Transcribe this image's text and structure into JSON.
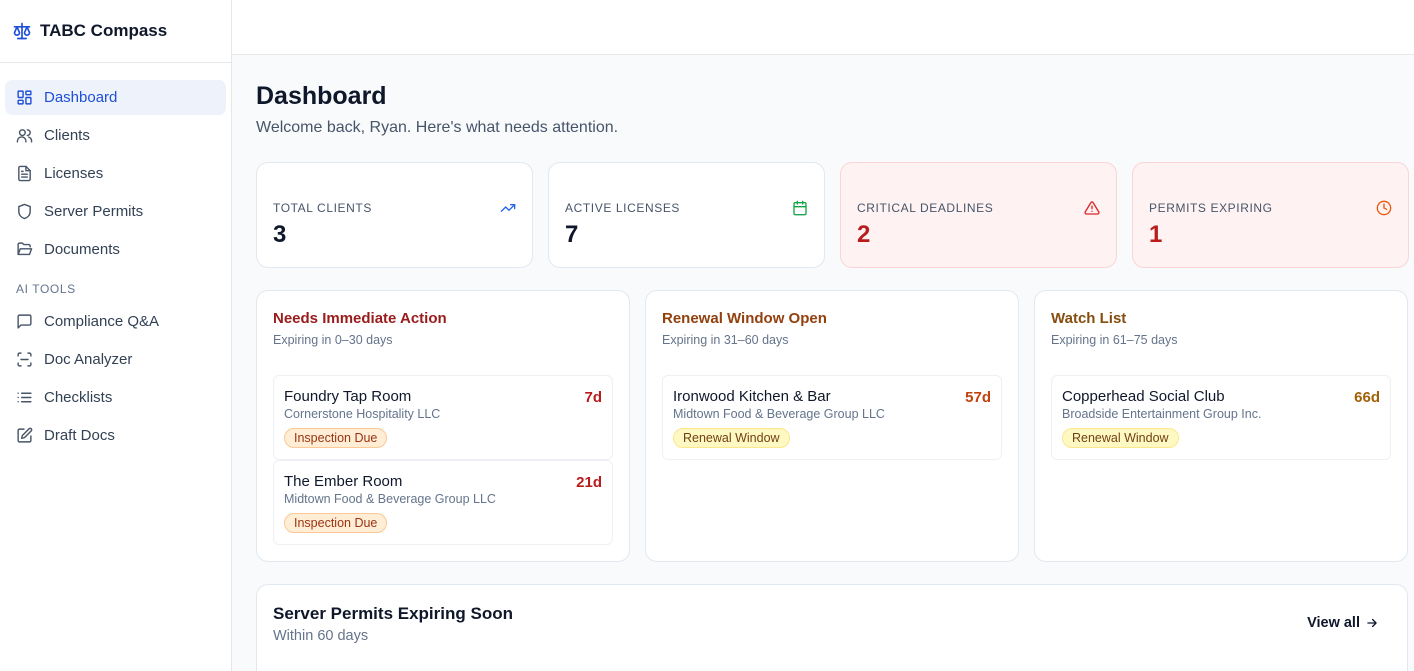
{
  "app": {
    "title": "TABC Compass"
  },
  "nav": {
    "items": [
      {
        "label": "Dashboard"
      },
      {
        "label": "Clients"
      },
      {
        "label": "Licenses"
      },
      {
        "label": "Server Permits"
      },
      {
        "label": "Documents"
      }
    ],
    "ai_section_label": "AI TOOLS",
    "ai_items": [
      {
        "label": "Compliance Q&A"
      },
      {
        "label": "Doc Analyzer"
      },
      {
        "label": "Checklists"
      },
      {
        "label": "Draft Docs"
      }
    ]
  },
  "page": {
    "title": "Dashboard",
    "subtitle": "Welcome back, Ryan. Here's what needs attention."
  },
  "stats": [
    {
      "label": "TOTAL CLIENTS",
      "value": "3",
      "icon": "trending-up-icon",
      "color": "#2563eb"
    },
    {
      "label": "ACTIVE LICENSES",
      "value": "7",
      "icon": "calendar-icon",
      "color": "#16a34a"
    },
    {
      "label": "CRITICAL DEADLINES",
      "value": "2",
      "icon": "alert-triangle-icon",
      "color": "#dc2626"
    },
    {
      "label": "PERMITS EXPIRING",
      "value": "1",
      "icon": "clock-icon",
      "color": "#ea580c"
    }
  ],
  "panels": [
    {
      "title": "Needs Immediate Action",
      "subtitle": "Expiring in 0–30 days",
      "title_color": "#991b1b",
      "entries": [
        {
          "name": "Foundry Tap Room",
          "org": "Cornerstone Hospitality LLC",
          "days": "7d",
          "badge": "Inspection Due"
        },
        {
          "name": "The Ember Room",
          "org": "Midtown Food & Beverage Group LLC",
          "days": "21d",
          "badge": "Inspection Due"
        }
      ]
    },
    {
      "title": "Renewal Window Open",
      "subtitle": "Expiring in 31–60 days",
      "title_color": "#92400e",
      "entries": [
        {
          "name": "Ironwood Kitchen & Bar",
          "org": "Midtown Food & Beverage Group LLC",
          "days": "57d",
          "badge": "Renewal Window"
        }
      ]
    },
    {
      "title": "Watch List",
      "subtitle": "Expiring in 61–75 days",
      "title_color": "#854d0e",
      "entries": [
        {
          "name": "Copperhead Social Club",
          "org": "Broadside Entertainment Group Inc.",
          "days": "66d",
          "badge": "Renewal Window"
        }
      ]
    }
  ],
  "permits": {
    "title": "Server Permits Expiring Soon",
    "subtitle": "Within 60 days",
    "view_all": "View all"
  }
}
